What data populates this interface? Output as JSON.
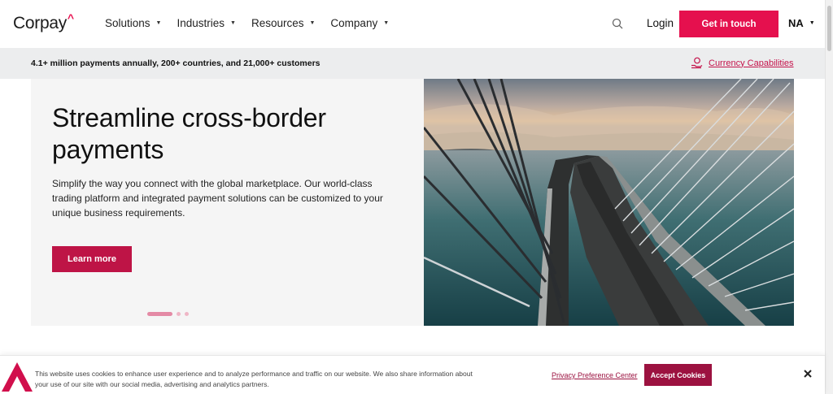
{
  "header": {
    "logo_text": "Corpay",
    "logo_caret": "^",
    "nav": [
      {
        "label": "Solutions"
      },
      {
        "label": "Industries"
      },
      {
        "label": "Resources"
      },
      {
        "label": "Company"
      }
    ],
    "search_icon": "search-icon",
    "login_label": "Login",
    "cta_label": "Get in touch",
    "region_label": "NA"
  },
  "strip": {
    "stats_text": "4.1+ million payments annually, 200+ countries, and 21,000+ customers",
    "link_label": "Currency Capabilities",
    "link_icon": "currency-exchange-icon"
  },
  "hero": {
    "title": "Streamline cross-border payments",
    "body": "Simplify the way you connect with the global marketplace. Our world-class trading platform and integrated payment solutions can be customized to your unique business requirements.",
    "button_label": "Learn more",
    "carousel": {
      "slides": 3,
      "active": 1
    }
  },
  "cookie_banner": {
    "text": "This website uses cookies to enhance user experience and to analyze performance and traffic on our website. We also share information about your use of our site with our social media, advertising and analytics partners.",
    "privacy_label": "Privacy Preference Center",
    "accept_label": "Accept Cookies",
    "close_icon": "close-icon"
  },
  "colors": {
    "brand_pink": "#e5104e",
    "brand_maroon": "#be1446",
    "strip_bg": "#ecedee"
  }
}
